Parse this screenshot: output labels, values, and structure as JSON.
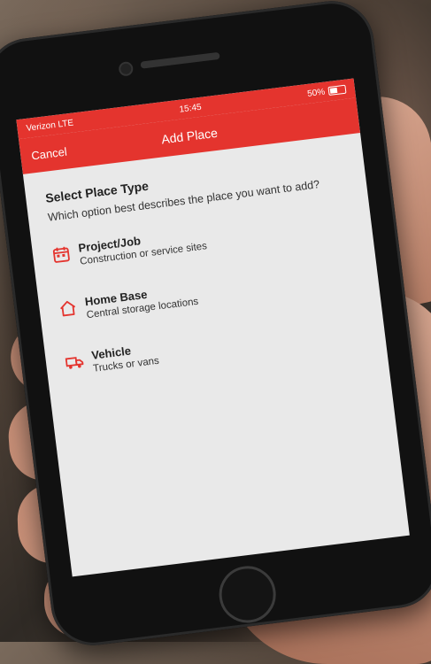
{
  "status": {
    "carrier": "Verizon LTE",
    "time": "15:45",
    "battery": "50%"
  },
  "nav": {
    "cancel_label": "Cancel",
    "title": "Add Place"
  },
  "main": {
    "heading": "Select Place Type",
    "subheading": "Which option best describes the place you want to add?",
    "options": [
      {
        "title": "Project/Job",
        "desc": "Construction or service sites",
        "icon": "calendar-icon"
      },
      {
        "title": "Home Base",
        "desc": "Central storage locations",
        "icon": "house-icon"
      },
      {
        "title": "Vehicle",
        "desc": "Trucks or vans",
        "icon": "truck-icon"
      }
    ]
  },
  "colors": {
    "accent": "#e4342e",
    "screen_bg": "#e9e9e9"
  }
}
